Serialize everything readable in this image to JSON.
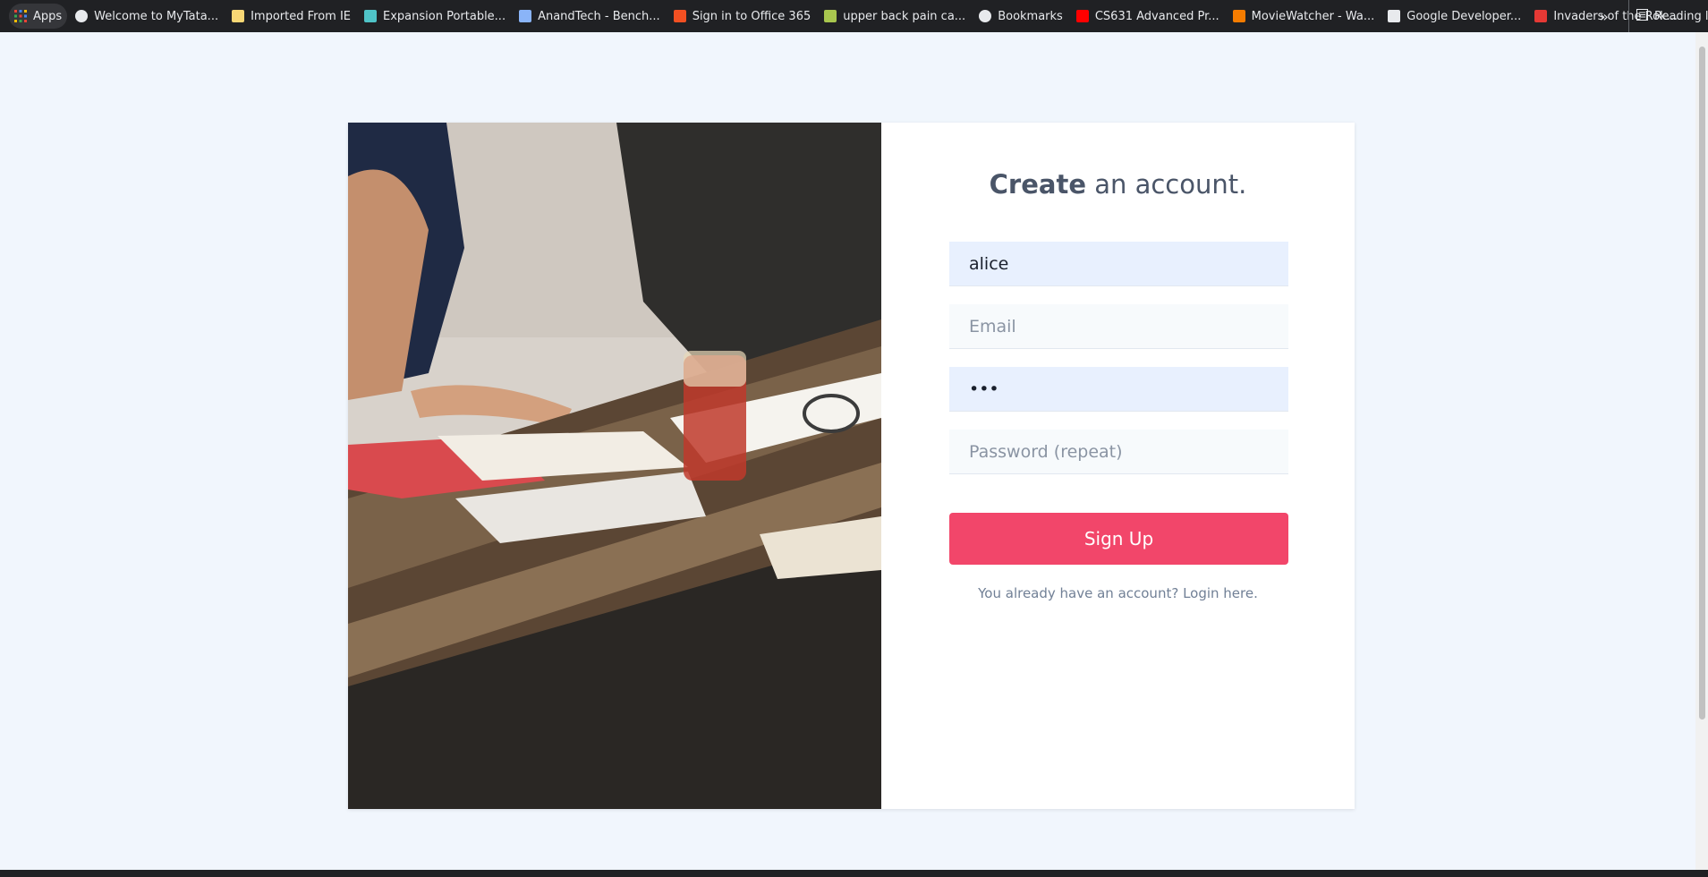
{
  "bookmarks": {
    "apps": "Apps",
    "items": [
      {
        "label": "Welcome to MyTata...",
        "icon": "globe-icon",
        "color": "#e8eaed"
      },
      {
        "label": "Imported From IE",
        "icon": "folder-icon",
        "color": "#f8d775"
      },
      {
        "label": "Expansion Portable...",
        "icon": "app-icon",
        "color": "#4fc3c7"
      },
      {
        "label": "AnandTech - Bench...",
        "icon": "anandtech-icon",
        "color": "#8ab4f8"
      },
      {
        "label": "Sign in to Office 365",
        "icon": "microsoft-icon",
        "color": "#f25022"
      },
      {
        "label": "upper back pain ca...",
        "icon": "leaf-icon",
        "color": "#a8c64e"
      },
      {
        "label": "Bookmarks",
        "icon": "star-icon",
        "color": "#e8eaed"
      },
      {
        "label": "CS631 Advanced Pr...",
        "icon": "youtube-icon",
        "color": "#ff0000"
      },
      {
        "label": "MovieWatcher - Wa...",
        "icon": "moviewatcher-icon",
        "color": "#f57c00"
      },
      {
        "label": "Google Developer...",
        "icon": "google-dev-icon",
        "color": "#e8eaed"
      },
      {
        "label": "Invaders of the Rok...",
        "icon": "pdf-icon",
        "color": "#e53935"
      }
    ],
    "overflow": "»",
    "reading_list": "Reading list"
  },
  "form": {
    "title_strong": "Create",
    "title_rest": " an account.",
    "username_value": "alice",
    "email_placeholder": "Email",
    "password_value": "•••",
    "password_repeat_placeholder": "Password (repeat)",
    "signup_label": "Sign Up",
    "login_prefix": "You already have an account? ",
    "login_link": "Login here."
  },
  "colors": {
    "page_bg": "#f1f6fd",
    "accent": "#f2466a",
    "filled_input_bg": "#e8f0fe"
  }
}
